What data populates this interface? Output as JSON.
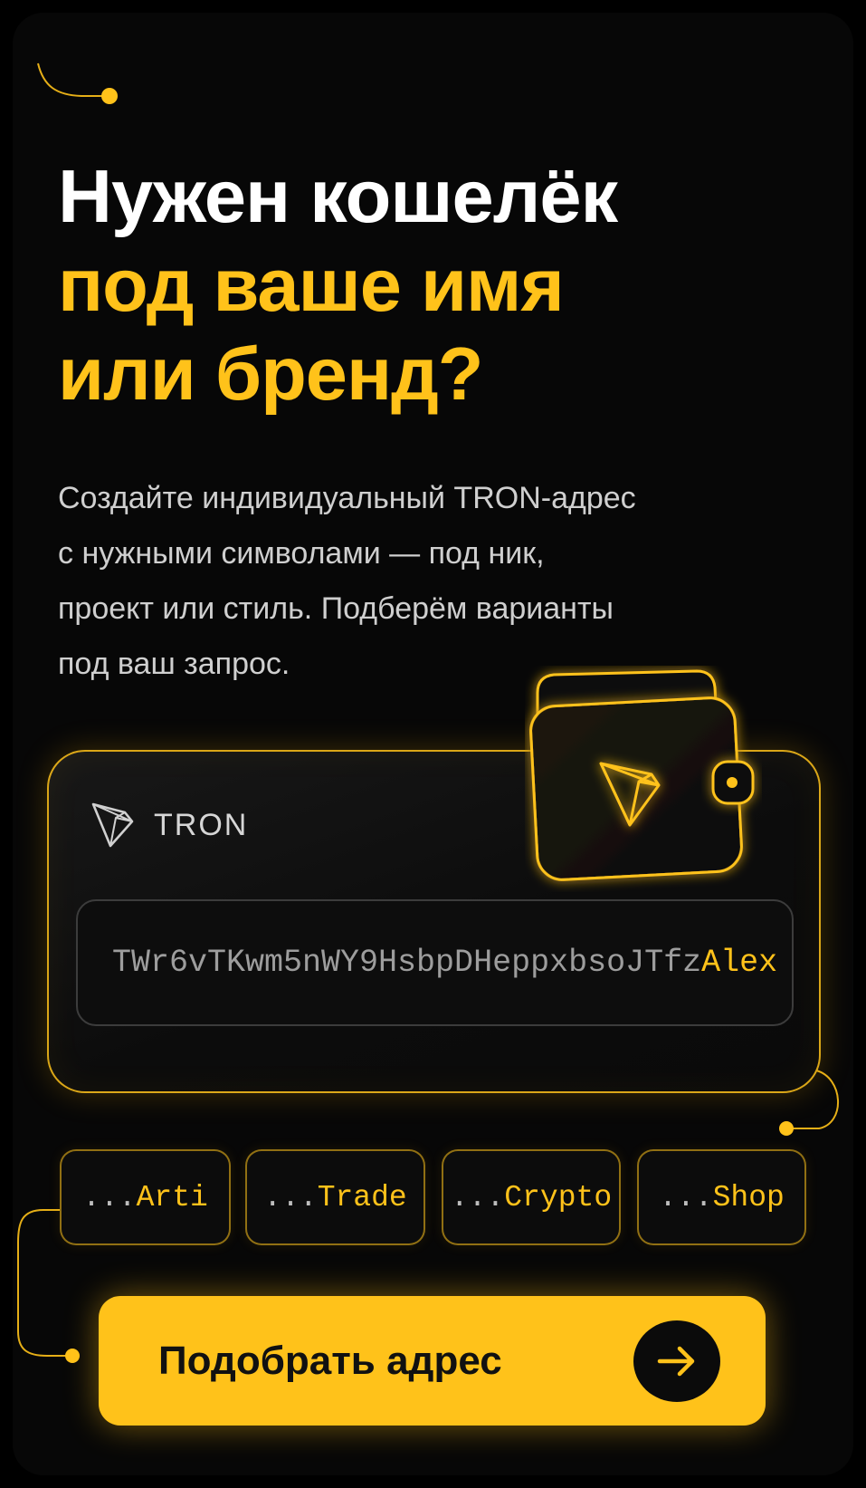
{
  "headline": {
    "line1": "Нужен кошелёк",
    "line2": "под ваше имя",
    "line3": "или бренд?"
  },
  "subtitle": {
    "lines": [
      "Создайте индивидуальный TRON-адрес",
      "с нужными символами — под ник,",
      "проект или стиль. Подберём варианты",
      "под ваш запрос."
    ]
  },
  "address_card": {
    "network_label": "TRON",
    "network_icon": "tron-logo-icon",
    "address_prefix": "TWr6vTKwm5nWY9HsbpDHeppxbsoJTfz",
    "address_suffix": "Alex"
  },
  "wallet_icon": "tron-wallet-icon",
  "suffix_chips": [
    {
      "dots": "...",
      "name": "Arti"
    },
    {
      "dots": "...",
      "name": "Trade"
    },
    {
      "dots": "...",
      "name": "Crypto"
    },
    {
      "dots": "...",
      "name": "Shop"
    }
  ],
  "cta": {
    "label": "Подобрать адрес",
    "icon": "arrow-right-icon"
  },
  "colors": {
    "background": "#070707",
    "accent": "#ffc21a",
    "text_primary": "#ffffff",
    "text_secondary": "#cfcfcf"
  }
}
